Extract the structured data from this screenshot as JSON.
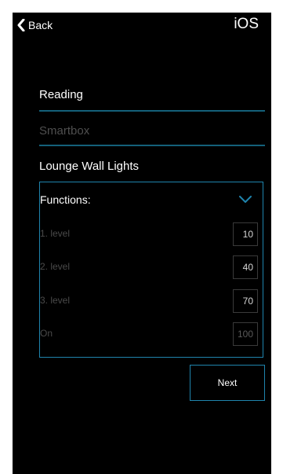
{
  "nav": {
    "back_label": "Back",
    "platform_label": "iOS"
  },
  "main": {
    "reading": "Reading",
    "device": "Smartbox",
    "light_name": "Lounge Wall Lights"
  },
  "functions": {
    "title": "Functions:",
    "items": [
      {
        "label": "1. level",
        "value": "10"
      },
      {
        "label": "2. level",
        "value": "40"
      },
      {
        "label": "3. level",
        "value": "70"
      },
      {
        "label": "On",
        "value": "100"
      }
    ]
  },
  "actions": {
    "next_label": "Next"
  },
  "colors": {
    "background": "#000000",
    "accent": "#1f84ad",
    "divider": "#14607a"
  }
}
